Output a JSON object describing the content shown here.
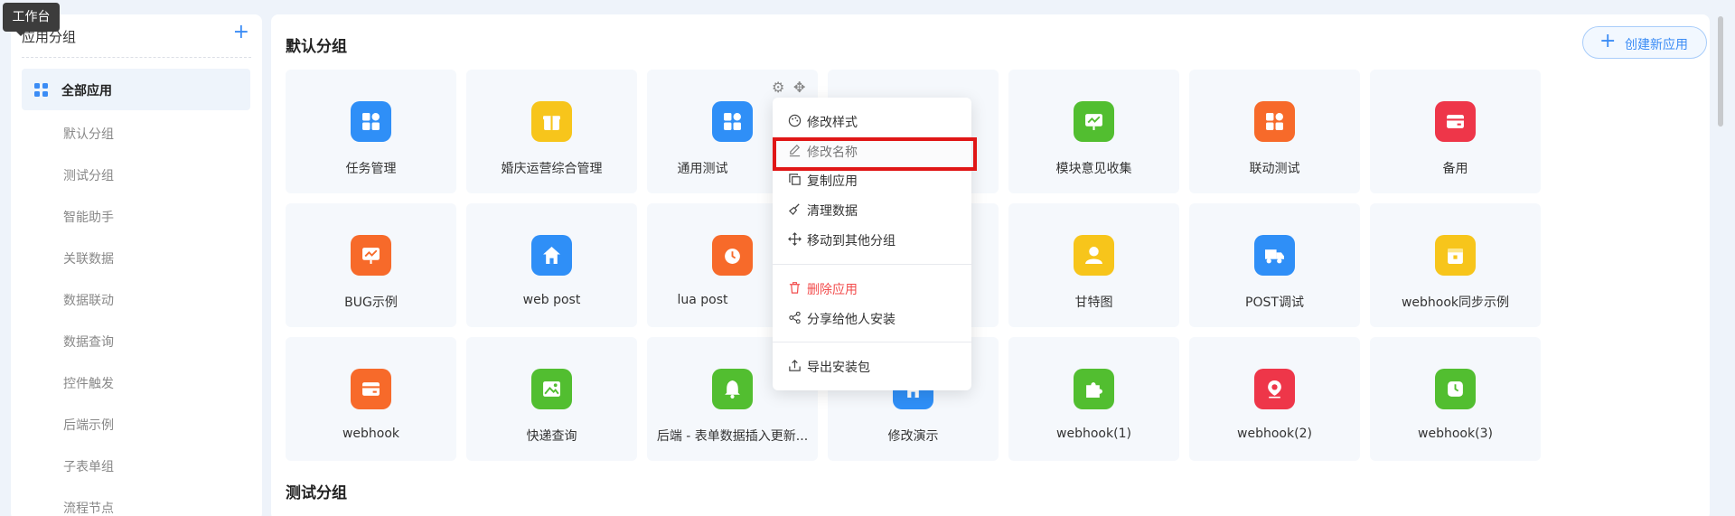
{
  "tooltip": "工作台",
  "sidebar": {
    "title": "应用分组",
    "add_icon": "plus-icon",
    "active_item": "全部应用",
    "items": [
      "默认分组",
      "测试分组",
      "智能助手",
      "关联数据",
      "数据联动",
      "数据查询",
      "控件触发",
      "后端示例",
      "子表单组",
      "流程节点"
    ]
  },
  "main": {
    "section_default": "默认分组",
    "section_test": "测试分组",
    "create_button": "创建新应用"
  },
  "apps": [
    {
      "name": "任务管理",
      "color": "#2f8ff7",
      "icon": "grid-icon"
    },
    {
      "name": "婚庆运营综合管理",
      "color": "#f7c51b",
      "icon": "gift-icon"
    },
    {
      "name": "通用测试",
      "color": "#2f8ff7",
      "icon": "grid-icon"
    },
    {
      "name": "模块意见收集",
      "color": "#52be30",
      "icon": "chart-board-icon"
    },
    {
      "name": "联动测试",
      "color": "#f76a2a",
      "icon": "grid-icon"
    },
    {
      "name": "备用",
      "color": "#ee3649",
      "icon": "card-icon"
    },
    {
      "name": "BUG示例",
      "color": "#f76a2a",
      "icon": "chart-board-icon"
    },
    {
      "name": "web post",
      "color": "#2f8ff7",
      "icon": "home-icon"
    },
    {
      "name": "lua post",
      "color": "#f76a2a",
      "icon": "alarm-icon"
    },
    {
      "name": "甘特图",
      "color": "#f7c51b",
      "icon": "user-icon"
    },
    {
      "name": "POST调试",
      "color": "#2f8ff7",
      "icon": "truck-icon"
    },
    {
      "name": "webhook同步示例",
      "color": "#f7c51b",
      "icon": "bag-icon"
    },
    {
      "name": "webhook",
      "color": "#f76a2a",
      "icon": "card-icon"
    },
    {
      "name": "快递查询",
      "color": "#52be30",
      "icon": "picture-icon"
    },
    {
      "name": "后端 - 表单数据插入更新...",
      "color": "#52be30",
      "icon": "bell-icon"
    },
    {
      "name": "修改演示",
      "color": "#2f8ff7",
      "icon": "home-icon"
    },
    {
      "name": "webhook(1)",
      "color": "#52be30",
      "icon": "puzzle-icon"
    },
    {
      "name": "webhook(2)",
      "color": "#ee3649",
      "icon": "location-icon"
    },
    {
      "name": "webhook(3)",
      "color": "#52be30",
      "icon": "clock-icon"
    }
  ],
  "menu": {
    "items": [
      {
        "label": "修改样式",
        "icon": "palette-icon"
      },
      {
        "label": "修改名称",
        "icon": "edit-icon"
      },
      {
        "label": "复制应用",
        "icon": "copy-icon"
      },
      {
        "label": "清理数据",
        "icon": "broom-icon"
      },
      {
        "label": "移动到其他分组",
        "icon": "move-icon"
      },
      {
        "label": "删除应用",
        "icon": "trash-icon",
        "danger": true
      },
      {
        "label": "分享给他人安装",
        "icon": "share-icon"
      },
      {
        "label": "导出安装包",
        "icon": "export-icon"
      }
    ]
  }
}
